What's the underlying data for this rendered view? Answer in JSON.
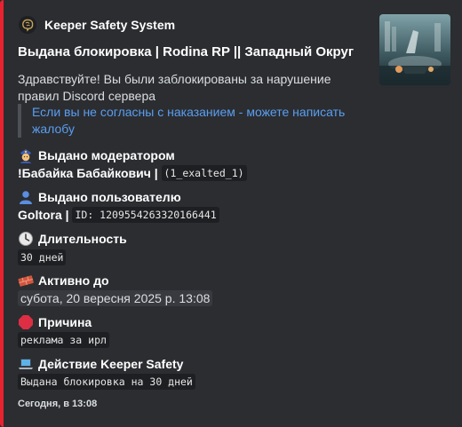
{
  "embed": {
    "accent_color": "#e8232f",
    "author": {
      "name": "Keeper Safety System",
      "icon": "brain-icon"
    },
    "title": "Выдана блокировка | Rodina RP || Западный Округ",
    "description": "Здравствуйте! Вы были заблокированы за нарушение правил Discord сервера",
    "quote": "Если вы не согласны с наказанием - можете написать жалобу",
    "fields": {
      "moderator": {
        "name": "Выдано модератором",
        "icon": "police-officer-icon",
        "value_text": "!Бабайка Бабайкович |",
        "value_code": "(1_exalted_1)"
      },
      "user": {
        "name": "Выдано пользователю",
        "icon": "bust-in-silhouette-icon",
        "value_text": "Goltora |",
        "value_code": "ID: 1209554263320166441"
      },
      "duration": {
        "name": "Длительность",
        "icon": "clock-icon",
        "value_code": "30 дней"
      },
      "active_until": {
        "name": "Активно до",
        "icon": "brick-icon",
        "value": "субота, 20 вересня 2025 р. 13:08"
      },
      "reason": {
        "name": "Причина",
        "icon": "stop-sign-icon",
        "value_code": "реклама за ирл"
      },
      "action": {
        "name": "Действие Keeper Safety",
        "icon": "laptop-icon",
        "value_code": "Выдана блокировка на 30 дней"
      }
    },
    "footer": "Сегодня, в 13:08"
  }
}
